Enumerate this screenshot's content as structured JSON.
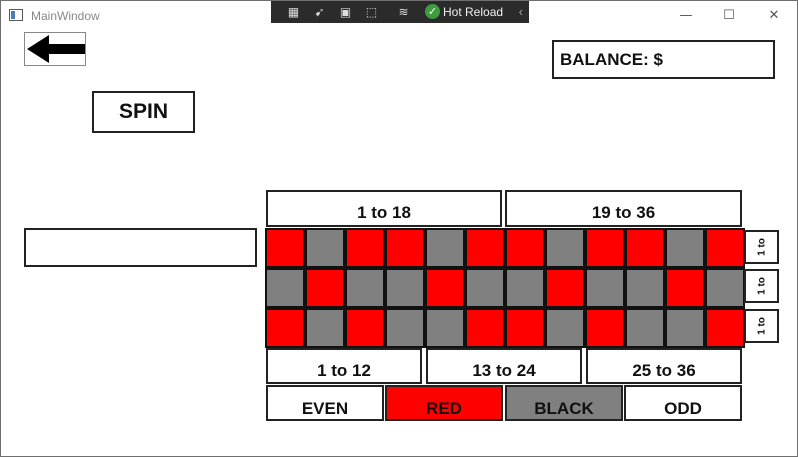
{
  "window": {
    "title": "MainWindow"
  },
  "debug_toolbar": {
    "hot_reload_label": "Hot Reload"
  },
  "balance": {
    "label": "BALANCE: $"
  },
  "spin": {
    "label": "SPIN"
  },
  "bet_input": {
    "value": ""
  },
  "halves": [
    {
      "label": "1 to 18"
    },
    {
      "label": "19 to 36"
    }
  ],
  "dozens": [
    {
      "label": "1 to 12"
    },
    {
      "label": "13 to 24"
    },
    {
      "label": "25 to 36"
    }
  ],
  "outside": [
    {
      "label": "EVEN",
      "bg": "#ffffff",
      "name": "even-bet"
    },
    {
      "label": "RED",
      "bg": "#ff0000",
      "name": "red-bet"
    },
    {
      "label": "BLACK",
      "bg": "#808080",
      "name": "black-bet"
    },
    {
      "label": "ODD",
      "bg": "#ffffff",
      "name": "odd-bet"
    }
  ],
  "column_bets": [
    {
      "label": "1 to"
    },
    {
      "label": "1 to"
    },
    {
      "label": "1 to"
    }
  ],
  "colors": {
    "red": "#ff0000",
    "black": "#808080"
  },
  "grid": [
    [
      "red",
      "black",
      "red",
      "red",
      "black",
      "red",
      "red",
      "black",
      "red",
      "red",
      "black",
      "red"
    ],
    [
      "black",
      "red",
      "black",
      "black",
      "red",
      "black",
      "black",
      "red",
      "black",
      "black",
      "red",
      "black"
    ],
    [
      "red",
      "black",
      "red",
      "black",
      "black",
      "red",
      "red",
      "black",
      "red",
      "black",
      "black",
      "red"
    ]
  ]
}
